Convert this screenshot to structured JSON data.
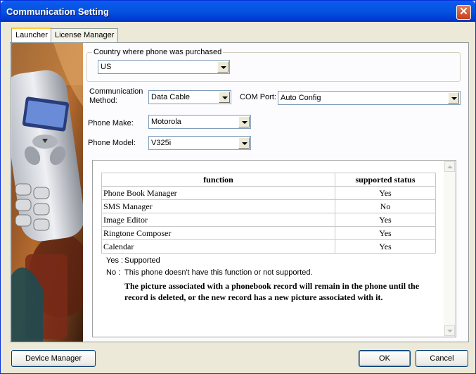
{
  "window": {
    "title": "Communication Setting",
    "close_glyph": "✕"
  },
  "tabs": [
    {
      "label": "Launcher",
      "active": true
    },
    {
      "label": "License Manager",
      "active": false
    }
  ],
  "country": {
    "group_label": "Country where phone was purchased",
    "value": "US"
  },
  "communication": {
    "label": "Communication Method:",
    "value": "Data Cable"
  },
  "com_port": {
    "label": "COM Port:",
    "value": "Auto Config"
  },
  "phone_make": {
    "label": "Phone Make:",
    "value": "Motorola"
  },
  "phone_model": {
    "label": "Phone Model:",
    "value": "V325i"
  },
  "functions": {
    "headers": [
      "function",
      "supported status"
    ],
    "rows": [
      {
        "name": "Phone Book Manager",
        "status": "Yes"
      },
      {
        "name": "SMS Manager",
        "status": "No"
      },
      {
        "name": "Image Editor",
        "status": "Yes"
      },
      {
        "name": "Ringtone Composer",
        "status": "Yes"
      },
      {
        "name": "Calendar",
        "status": "Yes"
      }
    ],
    "legend_yes_key": "Yes :",
    "legend_yes_text": "Supported",
    "legend_no_key": "No :",
    "legend_no_text": "This phone doesn't have this function or not supported.",
    "note": "The picture associated with a phonebook record will remain in the phone until the record is deleted, or the new record has a new picture associated with it."
  },
  "buttons": {
    "device_manager": "Device Manager",
    "ok": "OK",
    "cancel": "Cancel"
  },
  "colors": {
    "titlebar": "#0453E0",
    "window_bg": "#ECE9D8",
    "tab_highlight": "#FFC83C"
  }
}
